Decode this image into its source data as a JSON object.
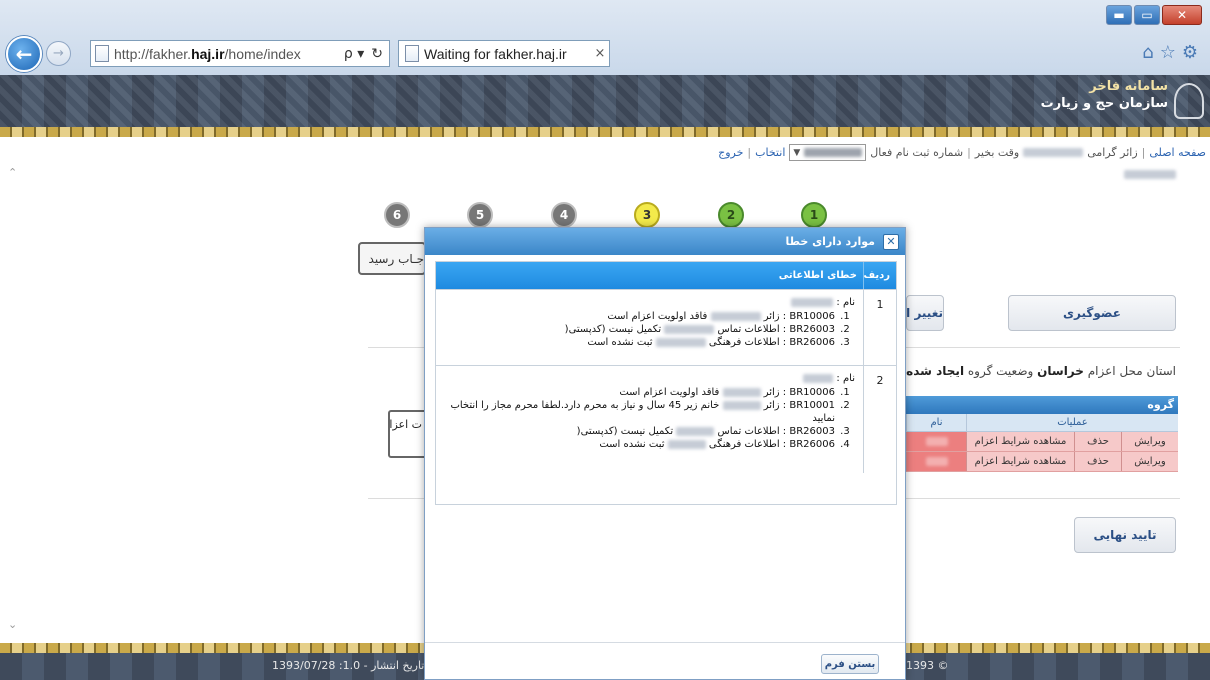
{
  "browser": {
    "url_prefix": "http://fakher.",
    "url_domain": "haj.ir",
    "url_path": "/home/index",
    "search_symbol": "ρ ▾",
    "refresh_symbol": "↻",
    "tab_title": "Waiting for fakher.haj.ir",
    "tab_close": "×",
    "back_symbol": "←",
    "forward_symbol": "→",
    "home_icon": "⌂",
    "favorites_icon": "☆",
    "settings_icon": "⚙",
    "minimize_symbol": "▬",
    "restore_symbol": "▭",
    "close_symbol": "✕"
  },
  "site": {
    "title_line1": "سامانه فاخر",
    "title_line2": "سازمان حج و زیارت"
  },
  "nav": {
    "home": "صفحه اصلی",
    "greeting_prefix": "زائر گرامی",
    "greeting_suffix": "وقت بخیر",
    "registration_label": "شماره ثبت نام فعال",
    "select_button": "انتخاب",
    "logout": "خروج"
  },
  "steps": [
    "6",
    "5",
    "4",
    "3",
    "2",
    "1"
  ],
  "page": {
    "receipt_button": "جـاب رسید",
    "change_province_button": "تغییر استان م",
    "membership_button": "عضوگیری",
    "province_label": "استان محل اعزام",
    "province_value": "خراسان",
    "group_status_label": "وضعیت گروه",
    "group_status_value": "ایجاد شده",
    "group_section_title": "گروه",
    "group_col_operations": "عملیات",
    "group_col_name": "نام",
    "group_rows": [
      {
        "edit": "ویرایش",
        "delete": "حذف",
        "view": "مشاهده شرایط اعزام"
      },
      {
        "edit": "ویرایش",
        "delete": "حذف",
        "view": "مشاهده شرایط اعزام"
      }
    ],
    "qualify_box_text": "ت اعزام",
    "final_confirm_button": "تایید نهایی",
    "footer_left": "1393/07/28 :تاریخ انتشار - 1.0",
    "footer_right": "1393 ©"
  },
  "modal": {
    "title": "موارد دارای خطا",
    "close_icon_glyph": "✕",
    "col_row": "ردیف",
    "col_error": "خطای اطلاعاتی",
    "name_label": "نام :",
    "close_form_button": "بستن فرم",
    "rows": [
      {
        "row_number": "1",
        "items": [
          {
            "code": "BR10006",
            "text_a": ": زائر",
            "text_b": "فاقد اولویت اعزام است"
          },
          {
            "code": "BR26003",
            "text_a": ": اطلاعات تماس",
            "text_b": "تکمیل نیست (کدپستی("
          },
          {
            "code": "BR26006",
            "text_a": ": اطلاعات فرهنگی",
            "text_b": "ثبت نشده است"
          }
        ]
      },
      {
        "row_number": "2",
        "items": [
          {
            "code": "BR10006",
            "text_a": ": زائر",
            "text_b": "فاقد اولویت اعزام است"
          },
          {
            "code": "BR10001",
            "text_a": ": زائر",
            "text_b": "خانم زیر 45 سال و نیاز به محرم دارد.لطفا محرم مجاز را انتخاب نمایید"
          },
          {
            "code": "BR26003",
            "text_a": ": اطلاعات تماس",
            "text_b": "تکمیل نیست (کدپستی("
          },
          {
            "code": "BR26006",
            "text_a": ": اطلاعات فرهنگی",
            "text_b": "ثبت نشده است"
          }
        ]
      }
    ]
  },
  "colors": {
    "modal_title_bar": "#3b86c8",
    "table_header": "#1e8ae0",
    "group_row_highlight": "#ec7f7f",
    "step_green": "#7ac143",
    "step_yellow": "#f3ea4b",
    "step_gray": "#777777"
  }
}
